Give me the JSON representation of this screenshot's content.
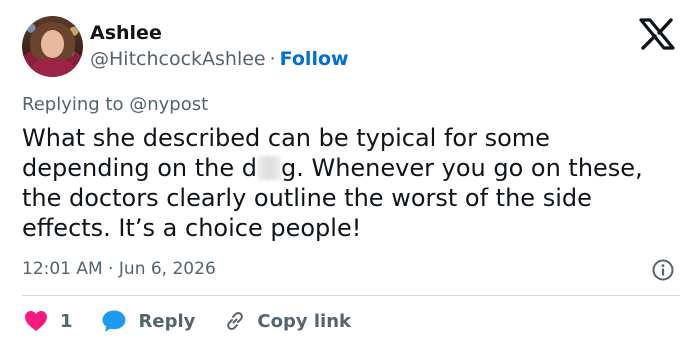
{
  "author": {
    "name": "Ashlee",
    "handle": "@HitchcockAshlee",
    "separator": "·",
    "follow_label": "Follow"
  },
  "reply_context": {
    "prefix": "Replying to",
    "mention": "@nypost"
  },
  "tweet": {
    "text_before_blur": "What she described can be typical for some depending on the d",
    "text_after_blur": "g. Whenever you go on these, the doctors clearly outline the worst of the side effects. It’s a choice people!",
    "timestamp": "12:01 AM · Jun 6, 2026"
  },
  "actions": {
    "like_count": "1",
    "reply_label": "Reply",
    "copy_link_label": "Copy link"
  },
  "colors": {
    "like": "#f91880",
    "reply": "#1d9bf0",
    "link": "#006fd6",
    "muted": "#536471"
  },
  "icons": {
    "logo": "x-logo-icon",
    "info": "info-icon",
    "like": "heart-icon",
    "reply": "speech-bubble-icon",
    "copy_link": "link-icon"
  }
}
